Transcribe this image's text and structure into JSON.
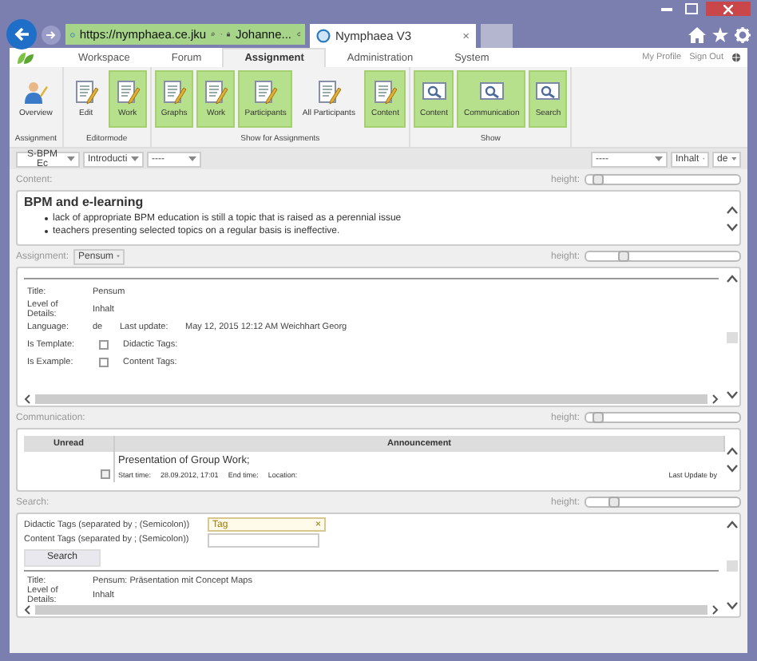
{
  "browser": {
    "address": "https://nymphaea.ce.jku",
    "site": "Johanne...",
    "tab": "Nymphaea V3",
    "close": "×"
  },
  "menu": [
    {
      "label": "Workspace",
      "selected": false
    },
    {
      "label": "Forum",
      "selected": false
    },
    {
      "label": "Assignment",
      "selected": true
    },
    {
      "label": "Administration",
      "selected": false
    },
    {
      "label": "System",
      "selected": false
    }
  ],
  "links": [
    "My Profile",
    "Sign Out"
  ],
  "ribbon_groups": [
    {
      "label": "Assignment",
      "buttons": [
        {
          "label": "Overview",
          "kind": "person",
          "selected": false
        }
      ]
    },
    {
      "label": "Editormode",
      "buttons": [
        {
          "label": "Edit",
          "kind": "document",
          "selected": false
        },
        {
          "label": "Work",
          "kind": "document",
          "selected": true
        }
      ]
    },
    {
      "label": "Show for Assignments",
      "buttons": [
        {
          "label": "Graphs",
          "kind": "document",
          "selected": true
        },
        {
          "label": "Work",
          "kind": "document",
          "selected": true
        },
        {
          "label": "Participants",
          "kind": "document",
          "selected": true
        },
        {
          "label": "All Participants",
          "kind": "document",
          "selected": false
        },
        {
          "label": "Content",
          "kind": "document",
          "selected": true
        }
      ]
    },
    {
      "label": "Show",
      "buttons": [
        {
          "label": "Content",
          "kind": "search",
          "selected": true
        },
        {
          "label": "Communication",
          "kind": "search",
          "selected": true
        },
        {
          "label": "Search",
          "kind": "search",
          "selected": true
        }
      ]
    }
  ],
  "toolbar": {
    "left": [
      "S-BPM Ec",
      "Introducti",
      "----"
    ],
    "right": [
      "----",
      "Inhalt",
      "de"
    ]
  },
  "content": {
    "label": "Content:",
    "height_label": "height:",
    "level": 0.05,
    "title": "BPM and e-learning",
    "bullets": [
      "lack of appropriate BPM education is still a topic that is raised as a perennial issue",
      "teachers presenting selected topics on a regular basis is ineffective."
    ]
  },
  "assignment": {
    "label": "Assignment:",
    "dropdown": "Pensum",
    "height_label": "height:",
    "level": 0.22,
    "fields": [
      {
        "kind": "text",
        "label": "Title:",
        "value": "Pensum"
      },
      {
        "kind": "text",
        "label": "Level of Details:",
        "value": "Inhalt"
      },
      {
        "kind": "text",
        "label": "Language:",
        "value": "de",
        "extra_label": "Last update:",
        "extra_value": "May 12, 2015 12:12 AM Weichhart Georg"
      },
      {
        "kind": "checkbox",
        "label": "Is Template:",
        "checked": false,
        "extra_label": "Didactic Tags:"
      },
      {
        "kind": "checkbox",
        "label": "Is Example:",
        "checked": false,
        "extra_label": "Content Tags:"
      }
    ]
  },
  "communication": {
    "label": "Communication:",
    "height_label": "height:",
    "level": 0.05,
    "columns": [
      "Unread",
      "Announcement"
    ],
    "rows": [
      {
        "title": "Presentation of Group Work;",
        "start_label": "Start time:",
        "start": "28.09.2012, 17:01",
        "end_label": "End time:",
        "location_label": "Location:",
        "update_label": "Last Update by"
      }
    ]
  },
  "search": {
    "label": "Search:",
    "height_label": "height:",
    "level": 0.16,
    "fields": [
      {
        "label": "Didactic Tags (separated by ; (Semicolon))",
        "value": "Tag",
        "clear": "×"
      },
      {
        "label": "Content Tags (separated by ; (Semicolon))"
      }
    ],
    "button": "Search",
    "results": [
      {
        "label": "Title:",
        "value": "Pensum: Präsentation mit Concept Maps"
      },
      {
        "label": "Level of Details:",
        "value": "Inhalt"
      }
    ]
  }
}
